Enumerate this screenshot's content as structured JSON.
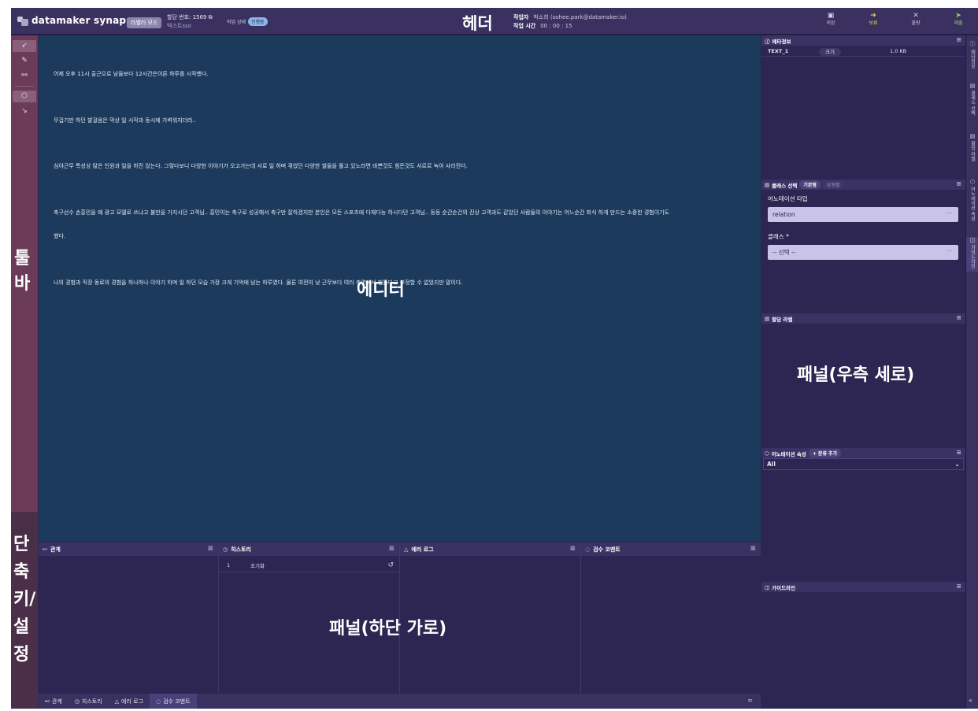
{
  "header": {
    "app_name": "datamaker synapse",
    "mode_badge": "라벨러 모드",
    "assignment_number": "할당 번호: 1569",
    "assignment_sub": "텍스트sso",
    "work_state_label": "작업 상태",
    "work_state_value": "진행중",
    "worker_label": "작업자",
    "worker_value": "박소희 (sohee.park@datamaker.io)",
    "work_time_label": "작업 시간",
    "work_time_value": "00 : 00 : 15",
    "actions": [
      {
        "label": "저장",
        "icon": "save-icon"
      },
      {
        "label": "보류",
        "icon": "arrow-right-icon"
      },
      {
        "label": "불량",
        "icon": "close-icon"
      },
      {
        "label": "제출",
        "icon": "send-icon"
      }
    ]
  },
  "toolbar": {
    "tools": [
      {
        "icon": "cursor-icon",
        "symbol": "➶",
        "active": true
      },
      {
        "icon": "pen-icon",
        "symbol": "✎",
        "active": false
      },
      {
        "icon": "link-icon",
        "symbol": "⚯",
        "active": false
      },
      {
        "icon": "tag-icon",
        "symbol": "⬡",
        "active": true
      },
      {
        "icon": "arrow-icon",
        "symbol": "↘",
        "active": false
      }
    ]
  },
  "editor": {
    "paragraphs": [
      "어제 오후 11시 출근으로 남들보다 12시간은이른 하루를 시작했다.",
      "무겁기만 하던 발걸음은 막상 일 시작과 동시에 가벼워지더라..",
      "심야근무 특성상 많은 인원과 일을 하진 않는다. 그렇다보니 다양한 이야기가 오고가는데 서로 일 하며 겪었던 다양한 썰들을 풀고 있노라면 바쁜것도 힘든것도 사르르 녹아 사라진다.",
      "축구선수 손흥민을 왜 광고 모델로 쓰냐고 불만을 가지시던 고객님.. 흥민이는 축구로 성공해서 축구만 잘하겠지만 본인은 모든 스포츠에 다재다능 하시다던 고객님.. 등등 순간순간의 진상 고객과도 같았던 사람들의 이야기는 어느순간 회식 하게 만드는 소중한 경험이기도",
      "했다.",
      "나의 경험과 직장 동료의 경험을 하나하나 이야기 하며 일 하던 모습 가장 크게 기억에 남는 하루였다. 물론 여전히 낮 근무보다 여러 측면에서 힘들다고 부정할 수 없었지만 말이다."
    ]
  },
  "bottom_panels": {
    "panels": [
      {
        "title": "관계",
        "icon": "link-icon"
      },
      {
        "title": "히스토리",
        "icon": "clock-icon"
      },
      {
        "title": "에러 로그",
        "icon": "warning-icon"
      },
      {
        "title": "검수 코멘트",
        "icon": "comment-icon"
      }
    ],
    "history_rows": [
      {
        "num": "1",
        "text": "초기화"
      }
    ],
    "tabs": [
      {
        "label": "관계",
        "icon": "link-icon"
      },
      {
        "label": "히스토리",
        "icon": "clock-icon"
      },
      {
        "label": "에러 로그",
        "icon": "warning-icon"
      },
      {
        "label": "검수 코멘트",
        "icon": "comment-icon"
      }
    ],
    "collapse_symbol": "≈"
  },
  "right_panel": {
    "meta_title": "메타정보",
    "meta_row": {
      "name": "TEXT_1",
      "size_label": "크기",
      "size_value": "1.0 KB"
    },
    "class_select_title": "클래스 선택",
    "class_chip_basic": "기본형",
    "class_chip_dim": "유형별",
    "annotation_type_label": "어노테이션 타입",
    "annotation_type_value": "relation",
    "class_label": "클래스 *",
    "class_value": "-- 선택 --",
    "assigned_label_title": "할당 라벨",
    "annotation_attr_title": "어노테이션 속성",
    "add_category": "+ 분류 추가",
    "attr_filter_value": "All",
    "guideline_title": "가이드라인"
  },
  "right_strip": {
    "tabs": [
      "메타정보",
      "클래스 선택",
      "할당 라벨",
      "어노테이션 속성",
      "가이드라인"
    ],
    "collapse_symbol": "«"
  },
  "overlay_labels": {
    "header": "헤더",
    "editor": "에디터",
    "right_panel": "패널(우측 세로)",
    "bottom_panel": "패널(하단 가로)",
    "toolbar": "툴바",
    "shortcut": "단축키/설정"
  }
}
